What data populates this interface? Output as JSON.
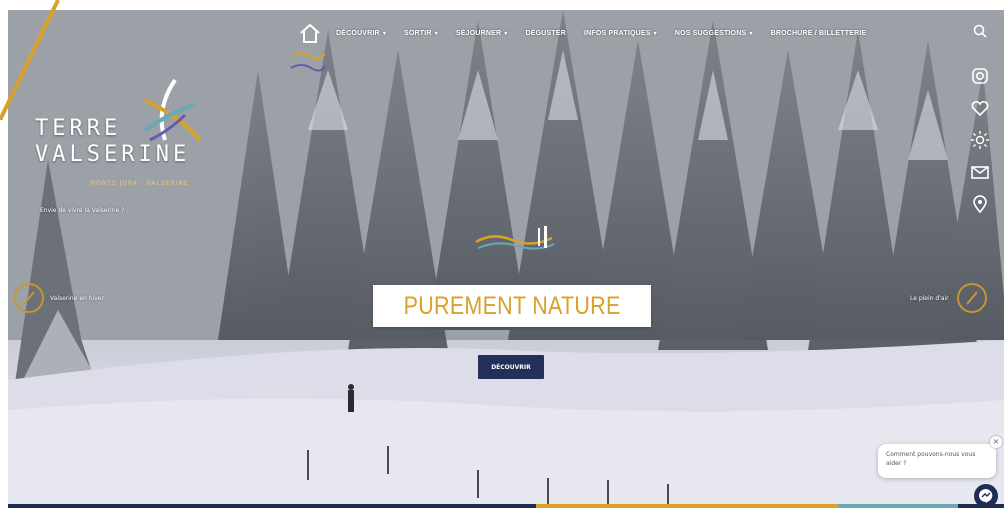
{
  "nav": {
    "items": [
      {
        "label": "DÉCOUVRIR",
        "dropdown": true
      },
      {
        "label": "SORTIR",
        "dropdown": true
      },
      {
        "label": "SÉJOURNER",
        "dropdown": true
      },
      {
        "label": "DÉGUSTER",
        "dropdown": false
      },
      {
        "label": "INFOS PRATIQUES",
        "dropdown": true
      },
      {
        "label": "NOS SUGGESTIONS",
        "dropdown": true
      },
      {
        "label": "BROCHURE / BILLETTERIE",
        "dropdown": false
      }
    ],
    "caret": "▾"
  },
  "logo": {
    "line1": "TERRE",
    "line2": "VALSERINE",
    "sub": "MONTS JURA · VALSERINE"
  },
  "tagline": "Envie de vivre la Valserine ?",
  "hero": {
    "title": "PUREMENT NATURE",
    "cta": "DÉCOUVRIR",
    "prev_label": "Valserine en hiver",
    "next_label": "Le plein d'air"
  },
  "side_icons": [
    "instagram-icon",
    "heart-icon",
    "sun-icon",
    "mail-icon",
    "location-icon"
  ],
  "chat": {
    "text": "Comment pouvons-nous vous aider ?",
    "close": "×"
  },
  "colors": {
    "accent": "#d9a128",
    "navy": "#23315a",
    "teal": "#6aa8b2"
  }
}
